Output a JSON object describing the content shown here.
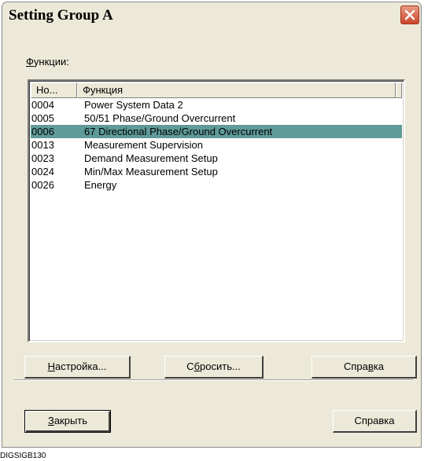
{
  "window": {
    "title": "Setting Group A"
  },
  "functions_label_accel": "Ф",
  "functions_label_rest": "ункции:",
  "list": {
    "columns": [
      "Но...",
      "Функция"
    ],
    "rows": [
      {
        "no": "0004",
        "name": "Power System Data 2",
        "selected": false
      },
      {
        "no": "0005",
        "name": "50/51 Phase/Ground Overcurrent",
        "selected": false
      },
      {
        "no": "0006",
        "name": "67 Directional Phase/Ground Overcurrent",
        "selected": true
      },
      {
        "no": "0013",
        "name": "Measurement Supervision",
        "selected": false
      },
      {
        "no": "0023",
        "name": "Demand Measurement Setup",
        "selected": false
      },
      {
        "no": "0024",
        "name": "Min/Max Measurement Setup",
        "selected": false
      },
      {
        "no": "0026",
        "name": "Energy",
        "selected": false
      }
    ]
  },
  "buttons": {
    "setup": {
      "accel": "Н",
      "rest": "астройка..."
    },
    "reset": {
      "pre": "С",
      "accel": "б",
      "rest": "росить..."
    },
    "help_top": {
      "pre": "Спра",
      "accel": "в",
      "rest": "ка"
    },
    "close": {
      "accel": "З",
      "rest": "акрыть"
    },
    "help_bottom": "Справка"
  },
  "caption": "DIGSIGB130",
  "colors": {
    "selection": "#5f9b98",
    "close_button": "#c8462a"
  }
}
